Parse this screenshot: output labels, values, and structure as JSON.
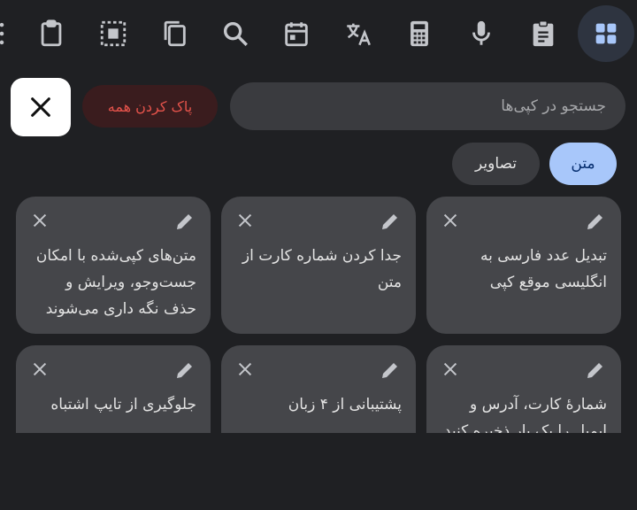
{
  "toolbar": {
    "icons": [
      "more-icon",
      "clipboard-icon",
      "select-all-icon",
      "copy-icon",
      "search-icon",
      "calendar-icon",
      "translate-icon",
      "calculator-icon",
      "microphone-icon",
      "clipboard-list-icon",
      "apps-grid-icon"
    ],
    "active": "apps-grid-icon"
  },
  "header": {
    "clear_all_label": "پاک کردن همه",
    "search_placeholder": "جستجو در کپی‌ها",
    "search_value": ""
  },
  "filters": {
    "text_label": "متن",
    "images_label": "تصاویر",
    "selected": "text"
  },
  "clips": [
    {
      "text": "تبدیل عدد فارسی به انگلیسی موقع کپی"
    },
    {
      "text": "جدا کردن شماره کارت از متن"
    },
    {
      "text": "متن‌های کپی‌شده با امکان جست‌وجو، ویرایش و حذف نگه داری می‌شوند"
    },
    {
      "text": "شمارهٔ کارت، آدرس و ایمیل را یک بار ذخیره کنید"
    },
    {
      "text": "پشتیبانی از ۴ زبان"
    },
    {
      "text": "جلوگیری از تایپ اشتباه"
    }
  ],
  "colors": {
    "background": "#1f2023",
    "card": "#45464a",
    "accent_chip": "#a8c7fa",
    "danger": "#e5534b"
  }
}
